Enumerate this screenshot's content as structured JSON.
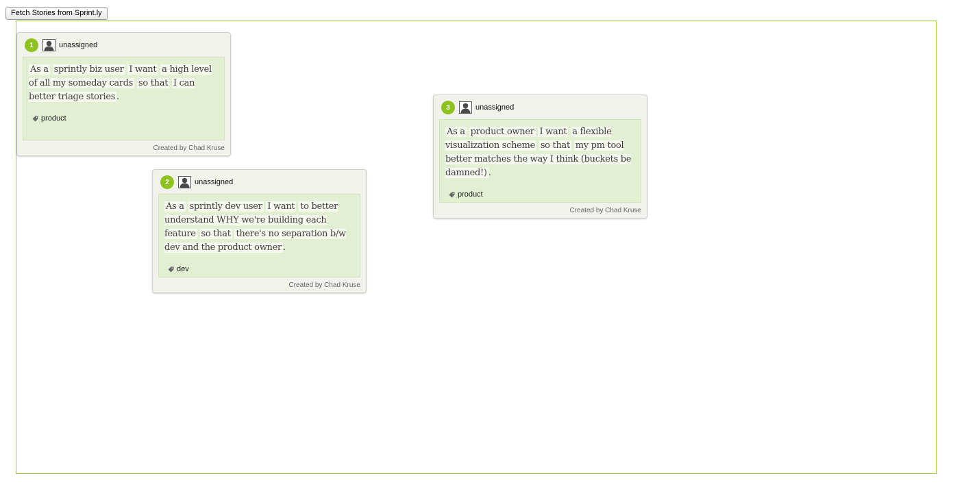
{
  "toolbar": {
    "fetch_label": "Fetch Stories from Sprint.ly"
  },
  "colors": {
    "accent": "#8dc21f",
    "board_border": "#9dc640",
    "card_bg": "#f2f2ed",
    "story_bg": "#e3efd3"
  },
  "cards": [
    {
      "number": "1",
      "assignee": "unassigned",
      "avatar_icon": "user-silhouette-icon",
      "story": {
        "prefix": "As a",
        "who": "sprintly biz user",
        "want_label": "I want",
        "what": "a high level of all my someday cards",
        "so_label": "so that",
        "why": "I can better triage stories",
        "end": "."
      },
      "tag_icon": "tag-icon",
      "tag": "product",
      "created_by": "Created by Chad Kruse"
    },
    {
      "number": "2",
      "assignee": "unassigned",
      "avatar_icon": "user-silhouette-icon",
      "story": {
        "prefix": "As a",
        "who": "sprintly dev user",
        "want_label": "I want",
        "what": "to better understand WHY we're building each feature",
        "so_label": "so that",
        "why": "there's no separation b/w dev and the product owner",
        "end": "."
      },
      "tag_icon": "tag-icon",
      "tag": "dev",
      "created_by": "Created by Chad Kruse"
    },
    {
      "number": "3",
      "assignee": "unassigned",
      "avatar_icon": "user-silhouette-icon",
      "story": {
        "prefix": "As a",
        "who": "product owner",
        "want_label": "I want",
        "what": "a flexible visualization scheme",
        "so_label": "so that",
        "why": "my pm tool better matches the way I think (buckets be damned!)",
        "end": "."
      },
      "tag_icon": "tag-icon",
      "tag": "product",
      "created_by": "Created by Chad Kruse"
    }
  ]
}
